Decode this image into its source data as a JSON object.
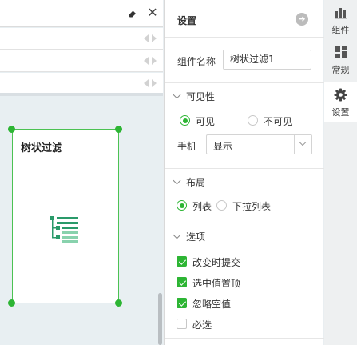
{
  "canvas": {
    "widget_title": "树状过滤"
  },
  "panel": {
    "title": "设置",
    "component_name_label": "组件名称",
    "component_name_value": "树状过滤1",
    "visibility": {
      "section_title": "可见性",
      "option_visible": "可见",
      "option_invisible": "不可见",
      "selected": "可见",
      "mobile_label": "手机",
      "mobile_value": "显示"
    },
    "layout": {
      "section_title": "布局",
      "option_list": "列表",
      "option_dropdown": "下拉列表",
      "selected": "列表"
    },
    "options": {
      "section_title": "选项",
      "items": [
        {
          "label": "改变时提交",
          "checked": true
        },
        {
          "label": "选中值置顶",
          "checked": true
        },
        {
          "label": "忽略空值",
          "checked": true
        },
        {
          "label": "必选",
          "checked": false
        }
      ]
    }
  },
  "rail": {
    "tabs": [
      {
        "label": "组件",
        "icon": "bar-chart-icon",
        "active": false
      },
      {
        "label": "常规",
        "icon": "grid-icon",
        "active": false
      },
      {
        "label": "设置",
        "icon": "gear-icon",
        "active": true
      }
    ]
  },
  "colors": {
    "accent": "#2db534",
    "widget_border": "#4cc253",
    "canvas_bg": "#e8eff2"
  }
}
